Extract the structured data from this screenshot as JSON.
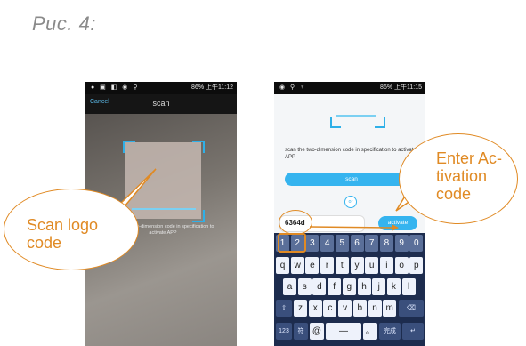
{
  "figure_label": "Рис. 4:",
  "left_phone": {
    "status_right": "86% 上午11:12",
    "cancel": "Cancel",
    "title": "scan",
    "instruction": "scan the two-dimension code in specification to activate APP"
  },
  "right_phone": {
    "status_right": "86% 上午11:15",
    "instruction": "scan the two-dimension code in specification to activate APP",
    "scan_button": "scan",
    "or_label": "or",
    "input_value": "6364d",
    "activate_button": "activate",
    "keyboard": {
      "row1": [
        "1",
        "2",
        "3",
        "4",
        "5",
        "6",
        "7",
        "8",
        "9",
        "0"
      ],
      "row2": [
        "q",
        "w",
        "e",
        "r",
        "t",
        "y",
        "u",
        "i",
        "o",
        "p"
      ],
      "row3": [
        "a",
        "s",
        "d",
        "f",
        "g",
        "h",
        "j",
        "k",
        "l"
      ],
      "row4": [
        "z",
        "x",
        "c",
        "v",
        "b",
        "n",
        "m"
      ],
      "row5": [
        "123",
        "符",
        "@",
        "—",
        "。",
        "完成"
      ]
    }
  },
  "callouts": {
    "left": "Scan logo code",
    "right": "Enter Ac-tivation code"
  },
  "colors": {
    "accent": "#e08a24",
    "app_blue": "#35b4ef"
  }
}
